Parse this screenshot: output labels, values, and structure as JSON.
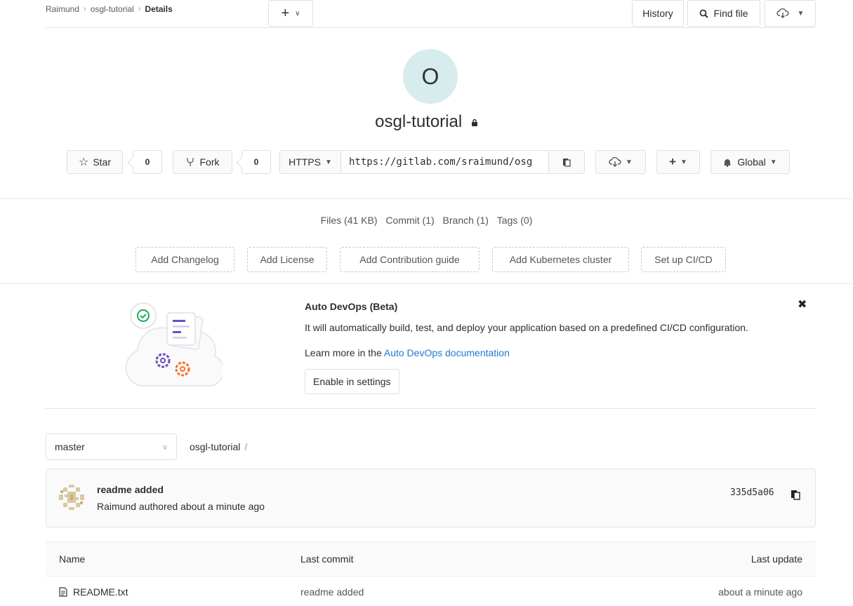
{
  "breadcrumb": {
    "owner": "Raimund",
    "project": "osgl-tutorial",
    "current": "Details"
  },
  "project": {
    "avatar_letter": "O",
    "name": "osgl-tutorial"
  },
  "controls": {
    "star_label": "Star",
    "star_count": "0",
    "fork_label": "Fork",
    "fork_count": "0",
    "protocol": "HTTPS",
    "clone_url": "https://gitlab.com/sraimund/osg",
    "notification": "Global"
  },
  "stats": {
    "files": "Files (41 KB)",
    "commit": "Commit (1)",
    "branch": "Branch (1)",
    "tags": "Tags (0)"
  },
  "quick_actions": [
    "Add Changelog",
    "Add License",
    "Add Contribution guide",
    "Add Kubernetes cluster",
    "Set up CI/CD"
  ],
  "auto_devops": {
    "title": "Auto DevOps (Beta)",
    "description": "It will automatically build, test, and deploy your application based on a predefined CI/CD configuration.",
    "learn_prefix": "Learn more in the ",
    "learn_link": "Auto DevOps documentation",
    "button": "Enable in settings"
  },
  "repo": {
    "branch": "master",
    "path": "osgl-tutorial",
    "history": "History",
    "find_file": "Find file"
  },
  "last_commit": {
    "title": "readme added",
    "meta": "Raimund authored about a minute ago",
    "sha": "335d5a06"
  },
  "table": {
    "headers": {
      "name": "Name",
      "last_commit": "Last commit",
      "last_update": "Last update"
    },
    "rows": [
      {
        "name": "README.txt",
        "last_commit": "readme added",
        "last_update": "about a minute ago"
      }
    ]
  },
  "colors": {
    "link": "#1f78d1",
    "avatar_bg": "#d7ecec",
    "success": "#1aaa55",
    "devops_purple": "#6b4fbb",
    "devops_orange": "#fc6d26"
  }
}
